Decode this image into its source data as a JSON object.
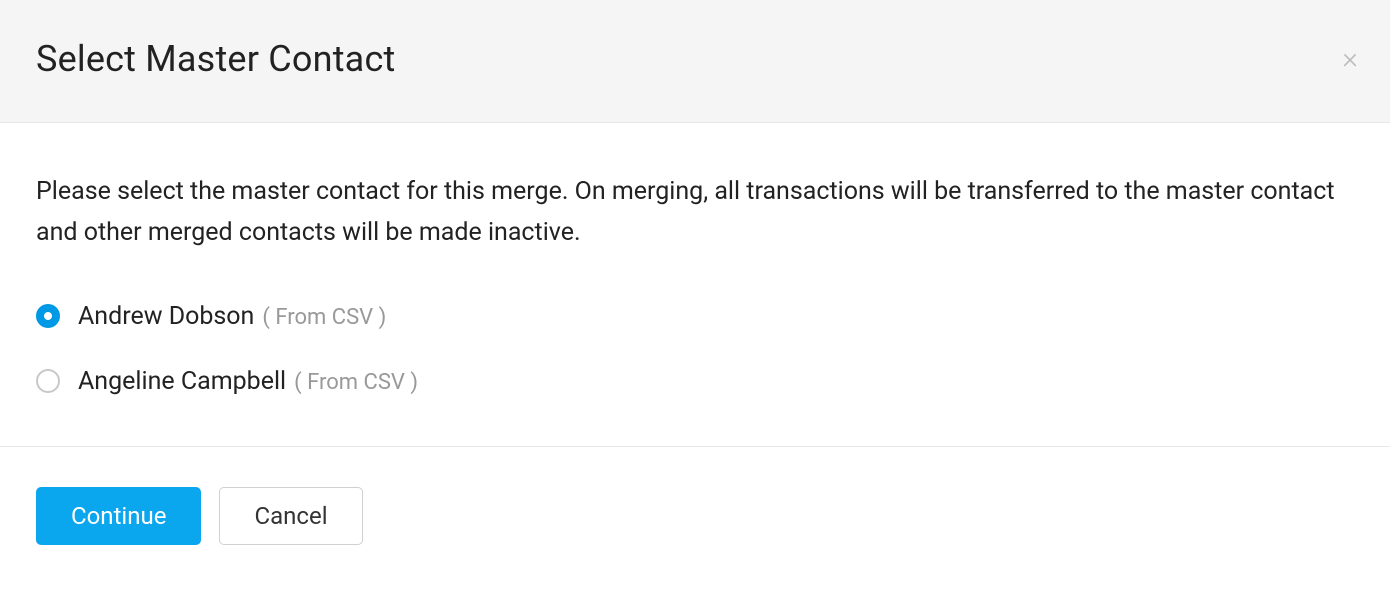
{
  "header": {
    "title": "Select Master Contact"
  },
  "body": {
    "description": "Please select the master contact for this merge. On merging, all transactions will be transferred to the master contact and other merged contacts will be made inactive.",
    "options": [
      {
        "name": "Andrew Dobson",
        "source": "( From CSV )",
        "selected": true
      },
      {
        "name": "Angeline Campbell",
        "source": "( From CSV )",
        "selected": false
      }
    ]
  },
  "footer": {
    "continue_label": "Continue",
    "cancel_label": "Cancel"
  }
}
